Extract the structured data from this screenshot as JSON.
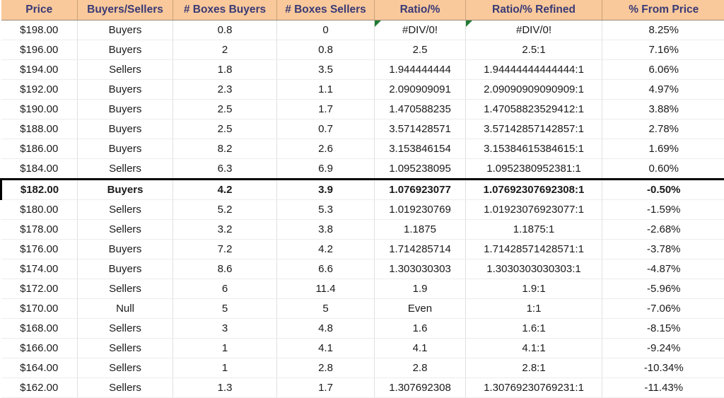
{
  "table": {
    "columns": [
      {
        "key": "price",
        "label": "Price"
      },
      {
        "key": "side",
        "label": "Buyers/Sellers"
      },
      {
        "key": "boxes_buyers",
        "label": "# Boxes Buyers"
      },
      {
        "key": "boxes_sellers",
        "label": "# Boxes Sellers"
      },
      {
        "key": "ratio",
        "label": "Ratio/%"
      },
      {
        "key": "refined",
        "label": "Ratio/% Refined"
      },
      {
        "key": "from_price",
        "label": "% From Price"
      }
    ],
    "colors": {
      "header_bg": "#F9C99B",
      "header_text": "#3A3A76",
      "buyers_bg": "#C6EBCA",
      "buyers_text": "#1E7020",
      "sellers_bg": "#FAC8CD",
      "sellers_text": "#B02034",
      "null_bg": "#F8DE91",
      "null_text": "#9C7B16",
      "highlight_border": "#000000",
      "error_flag": "#1E7B33"
    },
    "rows": [
      {
        "price": "$198.00",
        "side": "Buyers",
        "side_kind": "buyers",
        "boxes_buyers": "0.8",
        "boxes_sellers": "0",
        "ratio": "#DIV/0!",
        "refined": "#DIV/0!",
        "from_price": "8.25%",
        "highlight": false,
        "error_flag": true
      },
      {
        "price": "$196.00",
        "side": "Buyers",
        "side_kind": "buyers",
        "boxes_buyers": "2",
        "boxes_sellers": "0.8",
        "ratio": "2.5",
        "refined": "2.5:1",
        "from_price": "7.16%",
        "highlight": false,
        "error_flag": false
      },
      {
        "price": "$194.00",
        "side": "Sellers",
        "side_kind": "sellers",
        "boxes_buyers": "1.8",
        "boxes_sellers": "3.5",
        "ratio": "1.944444444",
        "refined": "1.94444444444444:1",
        "from_price": "6.06%",
        "highlight": false,
        "error_flag": false
      },
      {
        "price": "$192.00",
        "side": "Buyers",
        "side_kind": "buyers",
        "boxes_buyers": "2.3",
        "boxes_sellers": "1.1",
        "ratio": "2.090909091",
        "refined": "2.09090909090909:1",
        "from_price": "4.97%",
        "highlight": false,
        "error_flag": false
      },
      {
        "price": "$190.00",
        "side": "Buyers",
        "side_kind": "buyers",
        "boxes_buyers": "2.5",
        "boxes_sellers": "1.7",
        "ratio": "1.470588235",
        "refined": "1.47058823529412:1",
        "from_price": "3.88%",
        "highlight": false,
        "error_flag": false
      },
      {
        "price": "$188.00",
        "side": "Buyers",
        "side_kind": "buyers",
        "boxes_buyers": "2.5",
        "boxes_sellers": "0.7",
        "ratio": "3.571428571",
        "refined": "3.57142857142857:1",
        "from_price": "2.78%",
        "highlight": false,
        "error_flag": false
      },
      {
        "price": "$186.00",
        "side": "Buyers",
        "side_kind": "buyers",
        "boxes_buyers": "8.2",
        "boxes_sellers": "2.6",
        "ratio": "3.153846154",
        "refined": "3.15384615384615:1",
        "from_price": "1.69%",
        "highlight": false,
        "error_flag": false
      },
      {
        "price": "$184.00",
        "side": "Sellers",
        "side_kind": "sellers",
        "boxes_buyers": "6.3",
        "boxes_sellers": "6.9",
        "ratio": "1.095238095",
        "refined": "1.0952380952381:1",
        "from_price": "0.60%",
        "highlight": false,
        "error_flag": false
      },
      {
        "price": "$182.00",
        "side": "Buyers",
        "side_kind": "buyers",
        "boxes_buyers": "4.2",
        "boxes_sellers": "3.9",
        "ratio": "1.076923077",
        "refined": "1.07692307692308:1",
        "from_price": "-0.50%",
        "highlight": true,
        "error_flag": false
      },
      {
        "price": "$180.00",
        "side": "Sellers",
        "side_kind": "sellers",
        "boxes_buyers": "5.2",
        "boxes_sellers": "5.3",
        "ratio": "1.019230769",
        "refined": "1.01923076923077:1",
        "from_price": "-1.59%",
        "highlight": false,
        "error_flag": false
      },
      {
        "price": "$178.00",
        "side": "Sellers",
        "side_kind": "sellers",
        "boxes_buyers": "3.2",
        "boxes_sellers": "3.8",
        "ratio": "1.1875",
        "refined": "1.1875:1",
        "from_price": "-2.68%",
        "highlight": false,
        "error_flag": false
      },
      {
        "price": "$176.00",
        "side": "Buyers",
        "side_kind": "buyers",
        "boxes_buyers": "7.2",
        "boxes_sellers": "4.2",
        "ratio": "1.714285714",
        "refined": "1.71428571428571:1",
        "from_price": "-3.78%",
        "highlight": false,
        "error_flag": false
      },
      {
        "price": "$174.00",
        "side": "Buyers",
        "side_kind": "buyers",
        "boxes_buyers": "8.6",
        "boxes_sellers": "6.6",
        "ratio": "1.303030303",
        "refined": "1.3030303030303:1",
        "from_price": "-4.87%",
        "highlight": false,
        "error_flag": false
      },
      {
        "price": "$172.00",
        "side": "Sellers",
        "side_kind": "sellers",
        "boxes_buyers": "6",
        "boxes_sellers": "11.4",
        "ratio": "1.9",
        "refined": "1.9:1",
        "from_price": "-5.96%",
        "highlight": false,
        "error_flag": false
      },
      {
        "price": "$170.00",
        "side": "Null",
        "side_kind": "null",
        "boxes_buyers": "5",
        "boxes_sellers": "5",
        "ratio": "Even",
        "refined": "1:1",
        "from_price": "-7.06%",
        "highlight": false,
        "error_flag": false
      },
      {
        "price": "$168.00",
        "side": "Sellers",
        "side_kind": "sellers",
        "boxes_buyers": "3",
        "boxes_sellers": "4.8",
        "ratio": "1.6",
        "refined": "1.6:1",
        "from_price": "-8.15%",
        "highlight": false,
        "error_flag": false
      },
      {
        "price": "$166.00",
        "side": "Sellers",
        "side_kind": "sellers",
        "boxes_buyers": "1",
        "boxes_sellers": "4.1",
        "ratio": "4.1",
        "refined": "4.1:1",
        "from_price": "-9.24%",
        "highlight": false,
        "error_flag": false
      },
      {
        "price": "$164.00",
        "side": "Sellers",
        "side_kind": "sellers",
        "boxes_buyers": "1",
        "boxes_sellers": "2.8",
        "ratio": "2.8",
        "refined": "2.8:1",
        "from_price": "-10.34%",
        "highlight": false,
        "error_flag": false
      },
      {
        "price": "$162.00",
        "side": "Sellers",
        "side_kind": "sellers",
        "boxes_buyers": "1.3",
        "boxes_sellers": "1.7",
        "ratio": "1.307692308",
        "refined": "1.30769230769231:1",
        "from_price": "-11.43%",
        "highlight": false,
        "error_flag": false
      }
    ]
  }
}
